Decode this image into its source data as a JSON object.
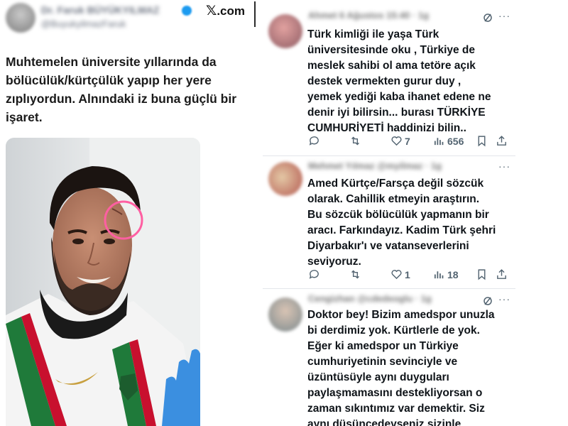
{
  "left_post": {
    "display_name": "Dr. Faruk BÜYÜKYILMAZ",
    "handle": "@BuyukyilmazFaruk",
    "brand": "𝕏.com",
    "brand_x": "𝕏",
    "brand_domain": ".com",
    "text_lines": [
      "Muhtemelen üniversite yıllarında da",
      "bölücülük/kürtçülük yapıp her yere",
      "zıplıyordun. Alnındaki iz buna güçlü bir",
      "işaret."
    ]
  },
  "replies": [
    {
      "header": "Ahmet 6 Ağustos 15:40 · 1g",
      "text_lines": [
        "Türk kimliği ile yaşa Türk",
        "üniversitesinde oku , Türkiye de",
        "meslek sahibi ol ama tetöre açık",
        "destek vermekten gurur duy ,",
        "yemek yediği kaba ihanet edene ne",
        "denir iyi bilirsin... burası TÜRKİYE",
        "CUMHURİYETİ haddinizi bilin.."
      ],
      "likes": "7",
      "views": "656",
      "retweets": "",
      "comments": ""
    },
    {
      "header": "Mehmet Yılmaz @myilmaz · 1g",
      "text_lines": [
        "Amed Kürtçe/Farsça değil sözcük",
        "olarak. Cahillik etmeyin araştırın.",
        "Bu sözcük bölücülük yapmanın bir",
        "aracı. Farkındayız. Kadim Türk şehri",
        "Diyarbakır'ı ve vatanseverlerini",
        "seviyoruz."
      ],
      "likes": "1",
      "views": "18",
      "retweets": "",
      "comments": ""
    },
    {
      "header": "Cengizhan @cdedeoglu · 1g",
      "text_lines": [
        "Doktor bey! Bizim amedspor unuzla",
        "bi derdimiz yok. Kürtlerle de yok.",
        "Eğer ki amedspor un Türkiye",
        "cumhuriyetinin sevinciyle ve",
        "üzüntüsüyle aynı duyguları",
        "paylaşmamasını destekliyorsan o",
        "zaman sıkıntımız var demektir. Siz",
        "aynı düşüncedeyseniz sizinle"
      ]
    }
  ],
  "colors": {
    "text": "#0f1419",
    "muted": "#536471",
    "circle_annotation": "#ff5fa2",
    "kit_green": "#1f7a3a",
    "kit_red": "#c8102e",
    "glove_blue": "#3b8fe0"
  }
}
